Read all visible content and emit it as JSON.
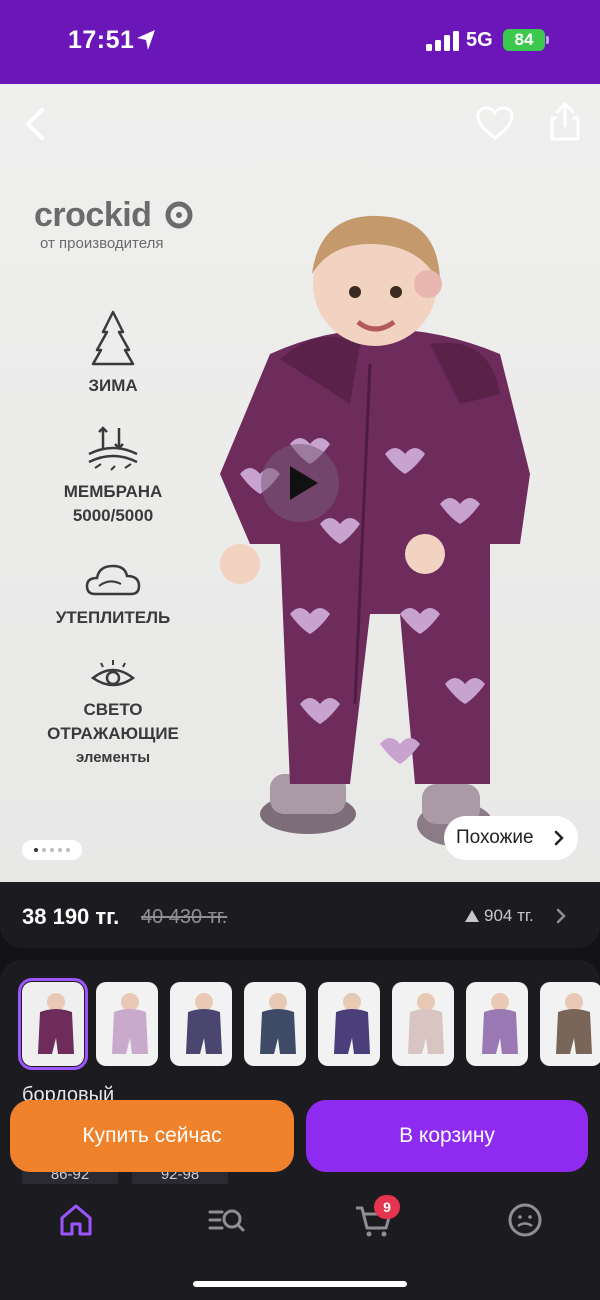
{
  "status_bar": {
    "time": "17:51",
    "network": "5G",
    "battery": "84"
  },
  "product_image": {
    "brand_name": "crockid",
    "brand_subtitle": "от производителя",
    "features": [
      {
        "icon": "snowflake-tree-icon",
        "line1": "ЗИМА",
        "line2": "",
        "line3": ""
      },
      {
        "icon": "membrane-icon",
        "line1": "МЕМБРАНА",
        "line2": "5000/5000",
        "line3": ""
      },
      {
        "icon": "cloud-insulation-icon",
        "line1": "УТЕПЛИТЕЛЬ",
        "line2": "",
        "line3": ""
      },
      {
        "icon": "eye-icon",
        "line1": "СВЕТО",
        "line2": "ОТРАЖАЮЩИЕ",
        "line3": "элементы"
      }
    ],
    "similar_label": "Похожие",
    "page_indicator": {
      "total": 5,
      "current": 1
    }
  },
  "price": {
    "current": "38 190 тг.",
    "old": "40 430 тг.",
    "bonus": "904 тг."
  },
  "variants": {
    "selected_color": "бордовый",
    "sizes": [
      "86-92",
      "92-98"
    ],
    "thumbnail_count": 8
  },
  "actions": {
    "buy_now": "Купить сейчас",
    "add_to_cart": "В корзину"
  },
  "nav": {
    "cart_badge": "9",
    "items": [
      "home-icon",
      "catalog-search-icon",
      "cart-icon",
      "profile-icon"
    ]
  },
  "colors": {
    "brand_purple": "#6a16b8",
    "button_orange": "#f0822b",
    "button_purple": "#8f2bf0",
    "badge_red": "#e5344e"
  }
}
